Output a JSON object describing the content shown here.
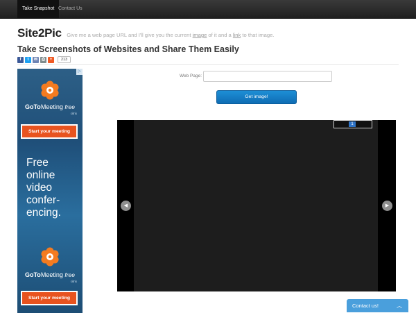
{
  "nav": {
    "items": [
      {
        "label": "Take Snapshot",
        "active": true
      },
      {
        "label": "Contact Us",
        "active": false
      }
    ]
  },
  "header": {
    "brand": "Site2Pic",
    "tagline_pre": "Give me a web page URL and I'll give you the current ",
    "tagline_image": "image",
    "tagline_mid": " of it and a ",
    "tagline_link": "link",
    "tagline_post": " to that image.",
    "headline": "Take Screenshots of Websites and Share Them Easily"
  },
  "share": {
    "count": "213",
    "buttons": [
      "facebook-icon",
      "twitter-icon",
      "email-icon",
      "print-icon",
      "more-icon"
    ],
    "colors": [
      "#3b5998",
      "#1da1f2",
      "#6d84b4",
      "#7f8c8d",
      "#f05a24"
    ]
  },
  "ad": {
    "logo_bold": "GoTo",
    "logo_regular": "Meeting",
    "logo_free": "free",
    "logo_sub": "citrix",
    "cta": "Start your meeting",
    "headline": "Free\nonline\nvideo\nconfer-\nencing.",
    "flag": "▷",
    "accent": "#e8531f"
  },
  "form": {
    "label": "Web Page:",
    "value": "",
    "button": "Get image!"
  },
  "viewer": {
    "zoom_value": "1",
    "prev_icon": "chevron-left-icon",
    "next_icon": "chevron-right-icon"
  },
  "contact_widget": {
    "label": "Contact us!",
    "icon": "chevron-up-icon",
    "color": "#4a9fdc"
  }
}
